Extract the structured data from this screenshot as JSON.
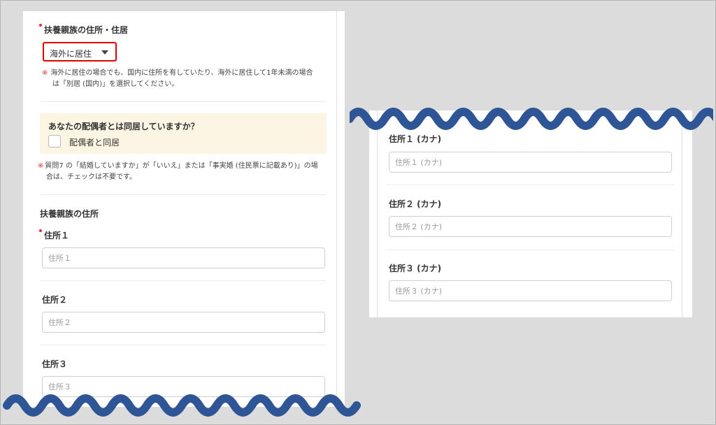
{
  "left_form": {
    "residence_label": "扶養親族の住所・住居",
    "residence_select_value": "海外に居住",
    "residence_note_mark": "※",
    "residence_note_line1": "海外に居住の場合でも、国内に住所を有していたり、海外に居住して1年未満の場合",
    "residence_note_line2": "は「別居 (国内)」を選択してください。",
    "spouse_question": "あなたの配偶者とは同居していますか？",
    "spouse_checkbox_label": "配偶者と同居",
    "spouse_checked": false,
    "spouse_note_mark": "※",
    "spouse_note_line1": "質問7 の「結婚していますか」が「いいえ」または「事実婚 (住民票に記載あり)」の場",
    "spouse_note_line2": "合は、チェックは不要です。",
    "address_section_title": "扶養親族の住所",
    "address1_label": "住所１",
    "address1_placeholder": "住所１",
    "address2_label": "住所２",
    "address2_placeholder": "住所２",
    "address3_label": "住所３",
    "address3_placeholder": "住所３"
  },
  "right_form": {
    "kana1_label": "住所１ (カナ)",
    "kana1_placeholder": "住所１ (カナ)",
    "kana2_label": "住所２ (カナ)",
    "kana2_placeholder": "住所２ (カナ)",
    "kana3_label": "住所３ (カナ)",
    "kana3_placeholder": "住所３ (カナ)"
  },
  "colors": {
    "background": "#dcdcdc",
    "required_dot": "#e32b2b",
    "highlight_border": "#e00000",
    "notice_bg": "#fdf5e3",
    "wave": "#2e5596"
  }
}
